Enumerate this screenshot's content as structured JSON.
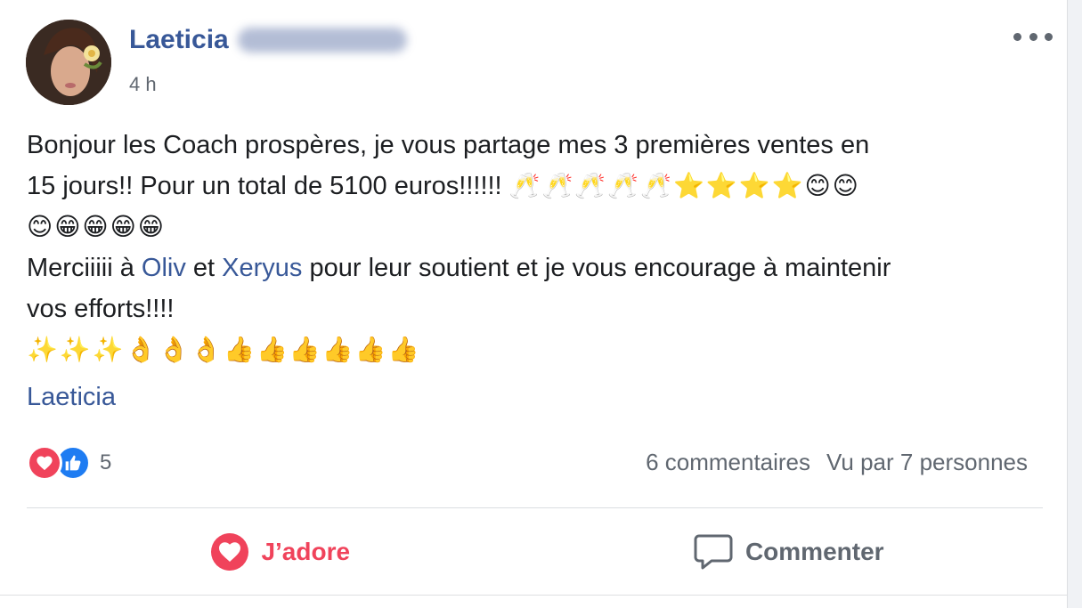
{
  "post": {
    "author_name": "Laeticia",
    "timestamp": "4 h",
    "text": {
      "line1": "Bonjour les Coach prospères, je vous partage mes 3 premières ventes en",
      "line2_text": "15 jours!! Pour un total de 5100 euros!!!!!! ",
      "line2_emojis": "🥂🥂🥂🥂🥂⭐⭐⭐⭐😊😊",
      "line3_emojis": "😊😁😁😁😁",
      "line4_before": "Merciiiii à ",
      "mention1": "Oliv",
      "line4_mid": " et ",
      "mention2": "Xeryus",
      "line4_after": " pour leur soutient et je vous encourage à maintenir",
      "line5": "vos efforts!!!!",
      "line6_emojis": "✨✨✨👌👌👌👍👍👍👍👍👍"
    },
    "signature": "Laeticia"
  },
  "reactions": {
    "count": "5",
    "icons": [
      "heart-icon",
      "thumbs-up-icon"
    ]
  },
  "stats": {
    "comments": "6 commentaires",
    "views": "Vu par 7 personnes"
  },
  "actions": {
    "love_label": "J’adore",
    "comment_label": "Commenter"
  },
  "colors": {
    "author_blue": "#385898",
    "love_red": "#f0435b",
    "like_blue": "#1e7cf2",
    "muted_gray": "#606770"
  }
}
